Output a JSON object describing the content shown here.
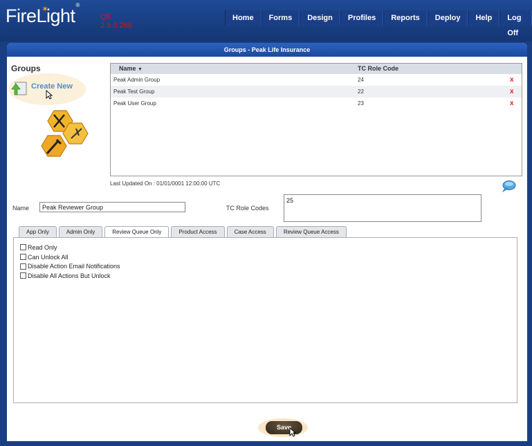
{
  "header": {
    "logo_text": "FireLight",
    "logo_mark": "®",
    "env_line1": "QE",
    "env_line2": "2.9.0.266"
  },
  "nav": {
    "items": [
      {
        "label": "Home"
      },
      {
        "label": "Forms"
      },
      {
        "label": "Design"
      },
      {
        "label": "Profiles"
      },
      {
        "label": "Reports"
      },
      {
        "label": "Deploy"
      },
      {
        "label": "Help"
      },
      {
        "label": "Log Off"
      }
    ]
  },
  "panel": {
    "title": "Groups - Peak Life Insurance",
    "groups_label": "Groups",
    "create_new_label": "Create New"
  },
  "grid": {
    "columns": [
      "Name",
      "TC Role Code"
    ],
    "sort_indicator": "▼",
    "rows": [
      {
        "name": "Peak Admin Group",
        "code": "24",
        "delete": "x"
      },
      {
        "name": "Peak Test Group",
        "code": "22",
        "delete": "x"
      },
      {
        "name": "Peak User Group",
        "code": "23",
        "delete": "x"
      }
    ]
  },
  "last_updated": "Last Updated On : 01/01/0001 12:00:00 UTC",
  "form": {
    "name_label": "Name",
    "name_value": "Peak Reviewer Group",
    "tc_label": "TC Role Codes",
    "tc_value": "25"
  },
  "tabs": [
    {
      "label": "App Only",
      "active": false
    },
    {
      "label": "Admin Only",
      "active": false
    },
    {
      "label": "Review Queue Only",
      "active": true
    },
    {
      "label": "Product Access",
      "active": false
    },
    {
      "label": "Case Access",
      "active": false
    },
    {
      "label": "Review Queue Access",
      "active": false
    }
  ],
  "checkboxes": [
    {
      "label": "Read Only",
      "checked": false
    },
    {
      "label": "Can Unlock All",
      "checked": false
    },
    {
      "label": "Disable Action Email Notifications",
      "checked": false
    },
    {
      "label": "Disable All Actions But Unlock",
      "checked": false
    }
  ],
  "save_label": "Save",
  "colors": {
    "header_bg": "#1a3e82",
    "env_text": "#d01818",
    "delete_x": "#e02020",
    "create_new_text": "#4d8ed0"
  }
}
